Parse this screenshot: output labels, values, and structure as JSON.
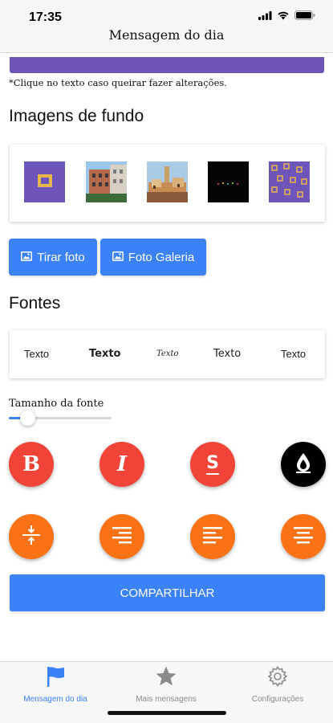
{
  "status_bar": {
    "time": "17:35"
  },
  "nav": {
    "title": "Mensagem do dia"
  },
  "content": {
    "hint": "*Clique no texto caso queirar fazer alterações.",
    "backgrounds_title": "Imagens de fundo",
    "photo_buttons": {
      "camera": "Tirar foto",
      "gallery": "Foto Galeria"
    },
    "fonts_title": "Fontes",
    "font_samples": [
      "Texto",
      "Texto",
      "Texto",
      "Texto",
      "Texto"
    ],
    "font_size_label": "Tamanho da fonte",
    "font_size_value": 0.18,
    "share_button": "COMPARTILHAR"
  },
  "colors": {
    "accent": "#3b82f6",
    "purple": "#6e55b9",
    "format_red": "#f04438",
    "align_orange": "#f97316"
  },
  "icons": [
    "bold-icon",
    "italic-icon",
    "strikethrough-icon",
    "color-drop-icon",
    "vertical-align-icon",
    "align-right-icon",
    "align-left-icon",
    "align-center-icon"
  ],
  "tabs": [
    {
      "label": "Mensagem do dia",
      "icon": "flag-icon",
      "active": true
    },
    {
      "label": "Mais mensagens",
      "icon": "star-icon",
      "active": false
    },
    {
      "label": "Configurações",
      "icon": "gear-icon",
      "active": false
    }
  ]
}
